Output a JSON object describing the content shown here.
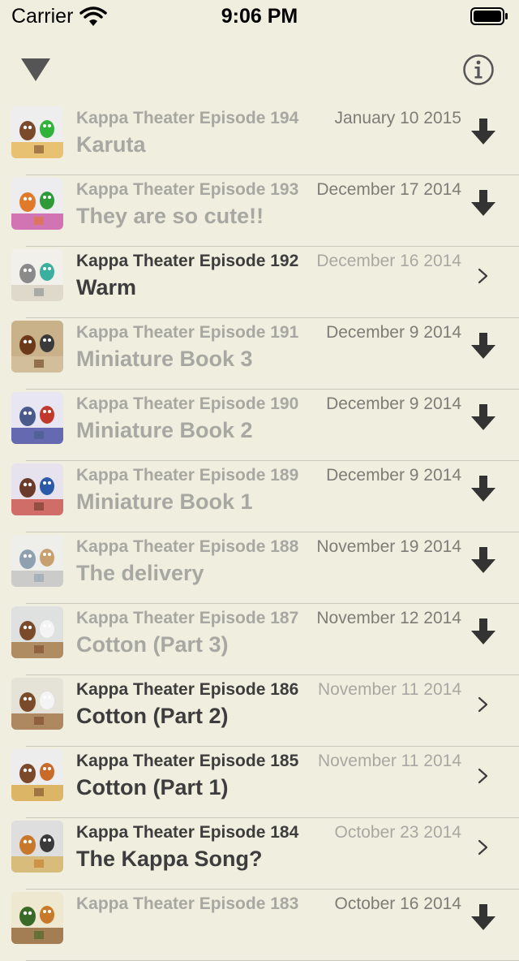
{
  "status_bar": {
    "carrier": "Carrier",
    "time": "9:06 PM",
    "icons": [
      "wifi-icon",
      "battery-icon"
    ]
  },
  "nav": {
    "left_icon": "triangle-down-icon",
    "right_icon": "info-icon"
  },
  "colors": {
    "background": "#efeedf",
    "text_dark": "#3d3d3d",
    "text_dim": "#a8a8a3",
    "separator": "#c8c7bc",
    "icon": "#333333"
  },
  "episodes": [
    {
      "episode": "Kappa Theater Episode 194",
      "date": "January 10 2015",
      "title": "Karuta",
      "state": "download",
      "icon": "download-arrow-icon"
    },
    {
      "episode": "Kappa Theater Episode 193",
      "date": "December 17 2014",
      "title": "They are so cute!!",
      "state": "download",
      "icon": "download-arrow-icon"
    },
    {
      "episode": "Kappa Theater Episode 192",
      "date": "December 16 2014",
      "title": "Warm",
      "state": "ready",
      "icon": "chevron-right-icon"
    },
    {
      "episode": "Kappa Theater Episode 191",
      "date": "December 9 2014",
      "title": "Miniature Book 3",
      "state": "download",
      "icon": "download-arrow-icon"
    },
    {
      "episode": "Kappa Theater Episode 190",
      "date": "December 9 2014",
      "title": "Miniature Book 2",
      "state": "download",
      "icon": "download-arrow-icon"
    },
    {
      "episode": "Kappa Theater Episode 189",
      "date": "December 9 2014",
      "title": "Miniature Book 1",
      "state": "download",
      "icon": "download-arrow-icon"
    },
    {
      "episode": "Kappa Theater Episode 188",
      "date": "November 19 2014",
      "title": "The delivery",
      "state": "download",
      "icon": "download-arrow-icon"
    },
    {
      "episode": "Kappa Theater Episode 187",
      "date": "November 12 2014",
      "title": "Cotton (Part 3)",
      "state": "download",
      "icon": "download-arrow-icon"
    },
    {
      "episode": "Kappa Theater Episode 186",
      "date": "November 11 2014",
      "title": "Cotton (Part 2)",
      "state": "ready",
      "icon": "chevron-right-icon"
    },
    {
      "episode": "Kappa Theater Episode 185",
      "date": "November 11 2014",
      "title": "Cotton (Part 1)",
      "state": "ready",
      "icon": "chevron-right-icon"
    },
    {
      "episode": "Kappa Theater Episode 184",
      "date": "October 23 2014",
      "title": "The Kappa Song?",
      "state": "ready",
      "icon": "chevron-right-icon"
    },
    {
      "episode": "Kappa Theater Episode 183",
      "date": "October 16 2014",
      "title": "",
      "state": "download",
      "icon": "download-arrow-icon"
    }
  ]
}
